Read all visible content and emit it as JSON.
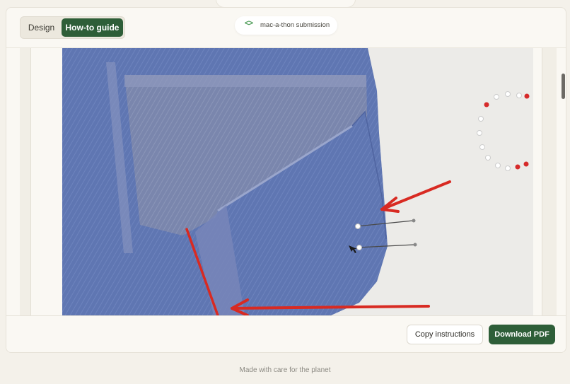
{
  "tabs": {
    "design": "Design",
    "howto": "How-to guide"
  },
  "submission": {
    "text": "mac-a-thon submission",
    "icon": "code-icon"
  },
  "photo": {
    "description_icon": "guide-photo"
  },
  "actions": {
    "copy": "Copy instructions",
    "download": "Download PDF"
  },
  "footer": {
    "text": "Made with care for the planet"
  },
  "colors": {
    "accent": "#2e5e38",
    "background": "#f4f1ea",
    "denim": "#5d74b0",
    "arrow": "#d82a22"
  }
}
